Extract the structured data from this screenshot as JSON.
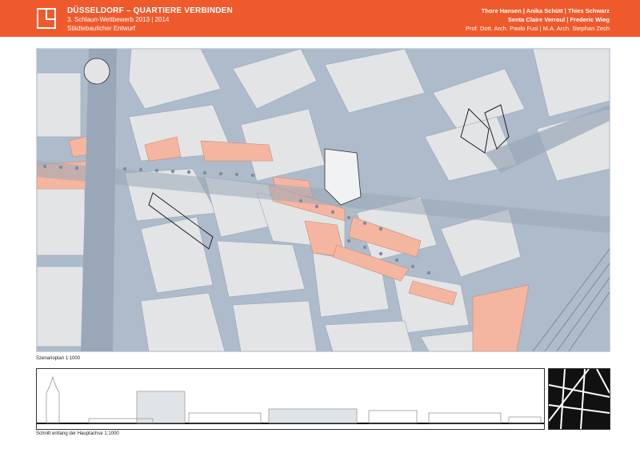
{
  "header": {
    "title": "DÜSSELDORF – QUARTIERE VERBINDEN",
    "subtitle_1": "3. Schlaun-Wettbewerb 2013 | 2014",
    "subtitle_2": "Städtebaulicher Entwurf",
    "authors_1": "Thore Hansen | Anika Schütt | Thies Schwarz",
    "authors_2": "Senta Claire Verroul | Frederic Wieg",
    "authors_3": "Prof. Dott. Arch. Paolo Fusi | M.A. Arch. Stephan Zech"
  },
  "captions": {
    "plan": "Szenarioplan 1:1000",
    "section": "Schnitt entlang der Hauptachse 1:1000"
  },
  "colors": {
    "header": "#ef5a2d",
    "street": "#aebbcb",
    "block": "#e2e4e6",
    "highlight": "#f4b6a0",
    "tree": "#7e8c9c"
  }
}
